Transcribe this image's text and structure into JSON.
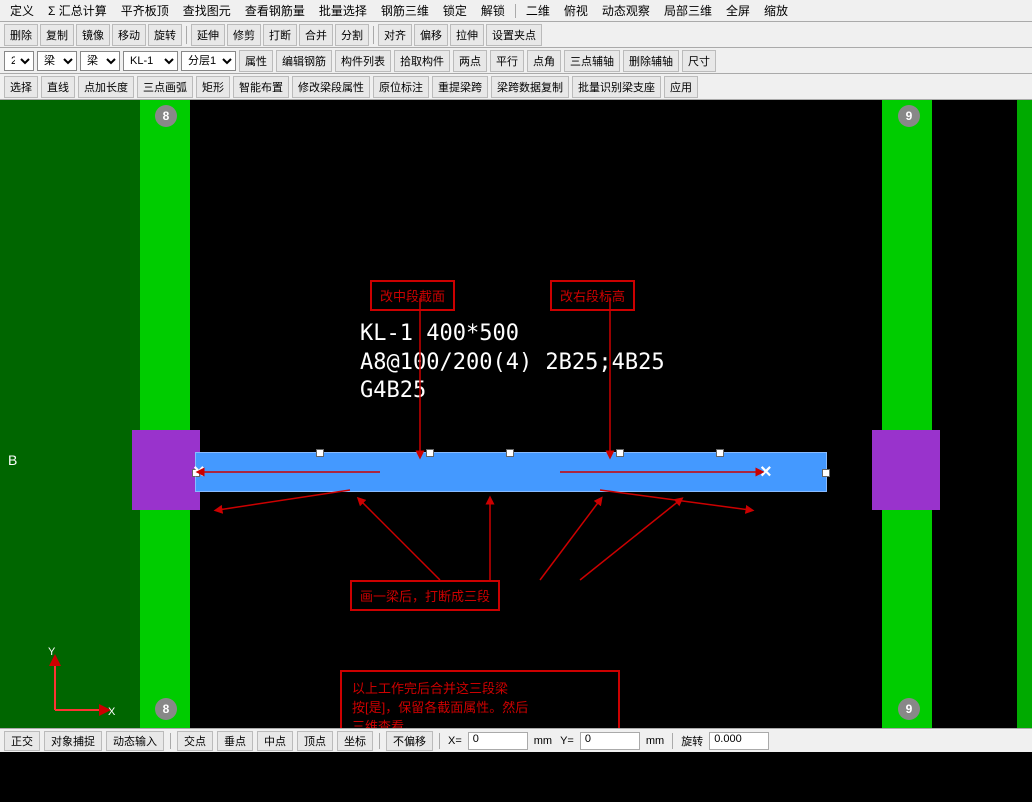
{
  "menubar": {
    "items": [
      "定义",
      "Σ 汇总计算",
      "平齐板顶",
      "查找图元",
      "查看钢筋量",
      "批量选择",
      "钢筋三维",
      "锁定",
      "解锁",
      "二维",
      "俯视",
      "动态观察",
      "局部三维",
      "全屏",
      "缩放"
    ]
  },
  "toolbar1": {
    "buttons": [
      "删除",
      "复制",
      "镜像",
      "移动",
      "旋转",
      "延伸",
      "修剪",
      "打断",
      "合并",
      "分割",
      "对齐",
      "偏移",
      "拉伸",
      "设置夹点"
    ]
  },
  "toolbar2": {
    "layer_num": "2",
    "type1": "梁",
    "type2": "梁",
    "element": "KL-1",
    "sublayer": "分层1",
    "buttons": [
      "属性",
      "编辑钢筋",
      "构件列表",
      "拾取构件",
      "两点",
      "平行",
      "点角",
      "三点辅轴",
      "删除辅轴",
      "尺寸"
    ]
  },
  "toolbar3": {
    "buttons": [
      "选择",
      "直线",
      "点加长度",
      "三点画弧",
      "矩形",
      "智能布置",
      "修改梁段属性",
      "原位标注",
      "重提梁跨",
      "梁跨数据复制",
      "批量识别梁支座",
      "应用"
    ]
  },
  "canvas": {
    "beam_label_line1": "KL-1 400*500",
    "beam_label_line2": "A8@100/200(4) 2B25;4B25",
    "beam_label_line3": "G4B25",
    "anno_top_left": "改中段截面",
    "anno_top_right": "改右段标高",
    "anno_bottom_note": "画一梁后，打断成三段",
    "anno_box_text_line1": "以上工作完后合并这三段梁",
    "anno_box_text_line2": "按[是]，保留各截面属性。然后",
    "anno_box_text_line3": "三维查看。",
    "circle_nums": [
      "8",
      "9",
      "8",
      "9"
    ],
    "b_marker": "B"
  },
  "statusbar": {
    "buttons": [
      "正交",
      "对象捕捉",
      "动态输入",
      "交点",
      "垂点",
      "中点",
      "顶点",
      "坐标"
    ],
    "mode": "不偏移",
    "x_label": "X=",
    "x_value": "0",
    "y_label": "Y=",
    "y_value": "0",
    "unit": "mm",
    "rotate_label": "旋转",
    "rotate_value": "0.000"
  }
}
